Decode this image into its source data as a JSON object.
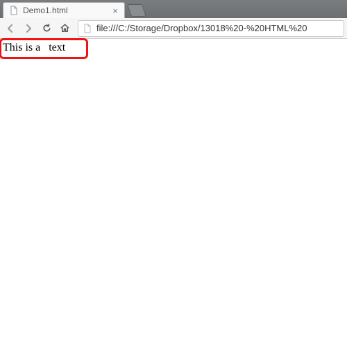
{
  "browser": {
    "tab": {
      "title": "Demo1.html",
      "close_glyph": "×"
    },
    "url": "file:///C:/Storage/Dropbox/13018%20-%20HTML%20"
  },
  "page": {
    "body_text": "This is a   text"
  }
}
